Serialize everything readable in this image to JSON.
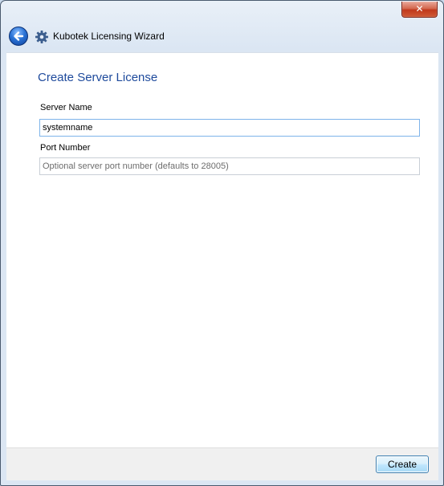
{
  "titlebar": {
    "close_glyph": "✕",
    "back_icon": "back-arrow-icon",
    "app_icon": "gear-icon",
    "title": "Kubotek Licensing Wizard"
  },
  "main": {
    "heading": "Create Server License",
    "server_name": {
      "label": "Server Name",
      "value": "systemname",
      "placeholder": ""
    },
    "port_number": {
      "label": "Port Number",
      "value": "",
      "placeholder": "Optional server port number (defaults to 28005)"
    }
  },
  "footer": {
    "create_label": "Create"
  },
  "colors": {
    "heading": "#1e4a9c",
    "close": "#c0391c",
    "focus_border": "#7eb4ea"
  }
}
